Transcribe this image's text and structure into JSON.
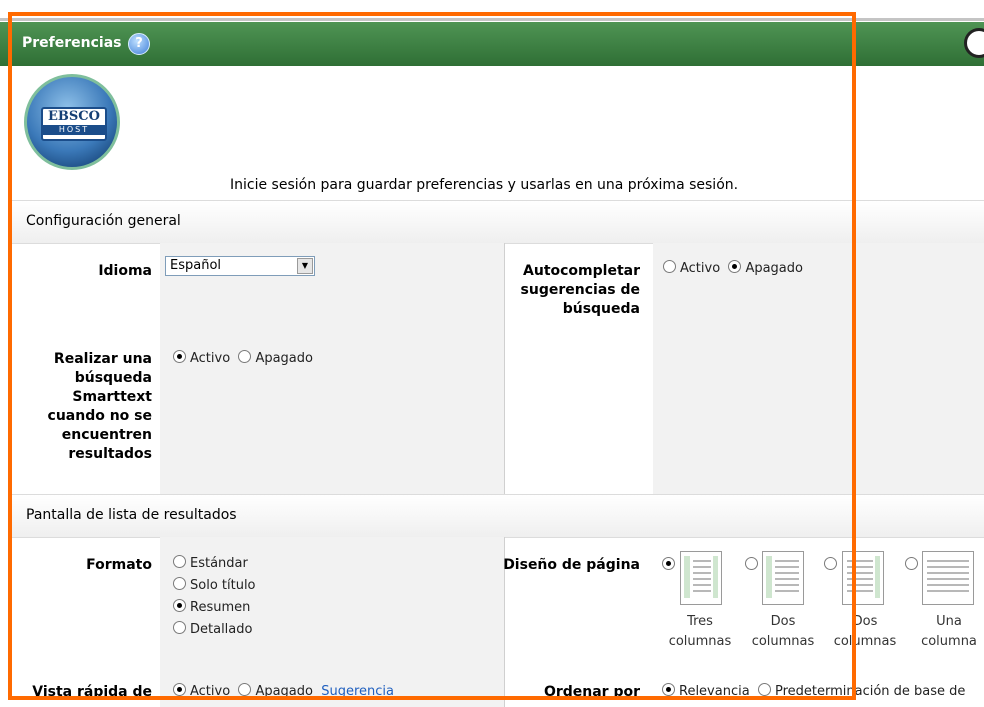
{
  "header": {
    "title": "Preferencias",
    "help_icon": "?"
  },
  "logo": {
    "line1": "EBSCO",
    "line2": "HOST"
  },
  "login_message": "Inicie sesión para guardar preferencias y usarlas en una próxima sesión.",
  "general": {
    "title": "Configuración general",
    "language": {
      "label": "Idioma",
      "value": "Español"
    },
    "autocomplete": {
      "label": "Autocompletar sugerencias de búsqueda",
      "on": "Activo",
      "off": "Apagado",
      "selected": "off"
    },
    "smarttext": {
      "label": "Realizar una búsqueda Smarttext cuando no se encuentren resultados",
      "on": "Activo",
      "off": "Apagado",
      "selected": "on"
    }
  },
  "results": {
    "title": "Pantalla de lista de resultados",
    "format": {
      "label": "Formato",
      "options": [
        "Estándar",
        "Solo título",
        "Resumen",
        "Detallado"
      ],
      "selected": 2
    },
    "page_layout": {
      "label": "Diseño de página",
      "options": [
        {
          "l1": "Tres",
          "l2": "columnas"
        },
        {
          "l1": "Dos",
          "l2": "columnas"
        },
        {
          "l1": "Dos",
          "l2": "columnas"
        },
        {
          "l1": "Una",
          "l2": "columna"
        }
      ],
      "selected": 0
    },
    "quick_view": {
      "label": "Vista rápida de",
      "on": "Activo",
      "off": "Apagado",
      "link": "Sugerencia"
    },
    "sort_by": {
      "label": "Ordenar por",
      "options": [
        "Relevancia",
        "Predeterminación de base de"
      ]
    }
  },
  "colors": {
    "header": "#3b7f41",
    "highlight_box": "#ff6a00",
    "link": "#1f5fbf"
  }
}
